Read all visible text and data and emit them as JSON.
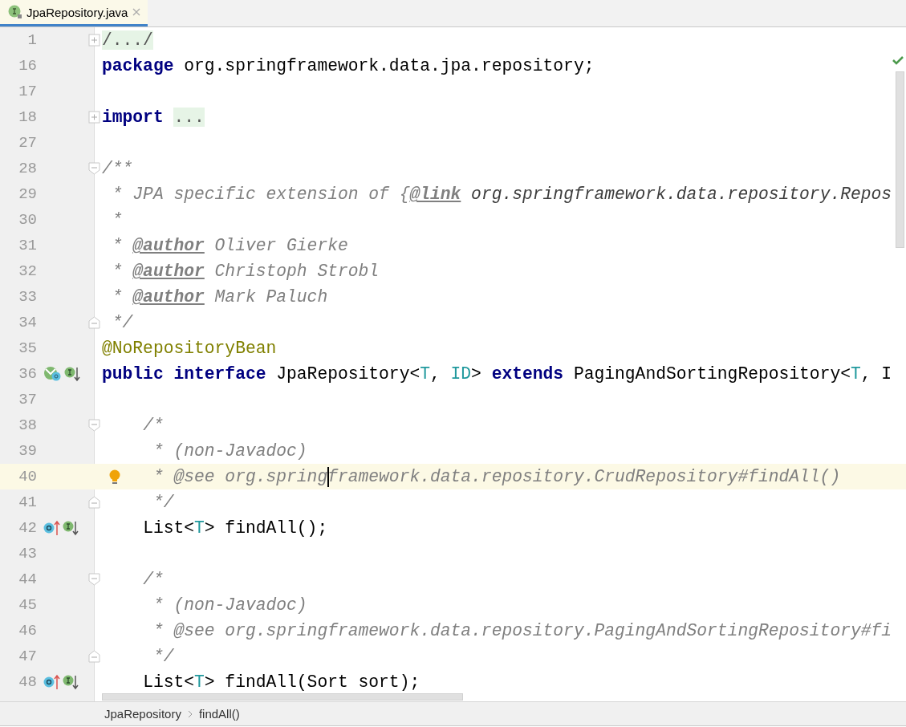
{
  "tabs": [
    {
      "label": "JpaRepository.java",
      "selected": true
    }
  ],
  "lines": [
    {
      "number": "1",
      "fold": {
        "kind": "expand"
      },
      "highlighted": false,
      "tokens": [
        {
          "text": "/.../",
          "kind": "folded"
        }
      ]
    },
    {
      "number": "16",
      "highlighted": false,
      "tokens": [
        {
          "text": "package",
          "kind": "keyword"
        },
        {
          "text": " org.springframework.data.jpa.repository;",
          "kind": "plain"
        }
      ]
    },
    {
      "number": "17",
      "highlighted": false
    },
    {
      "number": "18",
      "fold": {
        "kind": "expand"
      },
      "highlighted": false,
      "tokens": [
        {
          "text": "import ",
          "kind": "keyword"
        },
        {
          "text": "...",
          "kind": "folded"
        }
      ]
    },
    {
      "number": "27",
      "highlighted": false
    },
    {
      "number": "28",
      "fold": {
        "kind": "start"
      },
      "highlighted": false,
      "tokens": [
        {
          "text": "/**",
          "kind": "comment"
        }
      ]
    },
    {
      "number": "29",
      "highlighted": false,
      "tokens": [
        {
          "text": " * JPA specific extension of {",
          "kind": "comment"
        },
        {
          "text": "@link",
          "kind": "doc_tag"
        },
        {
          "text": " org.springframework.data.repository.Repos",
          "kind": "doc_ref"
        }
      ]
    },
    {
      "number": "30",
      "highlighted": false,
      "tokens": [
        {
          "text": " *",
          "kind": "comment"
        }
      ]
    },
    {
      "number": "31",
      "highlighted": false,
      "tokens": [
        {
          "text": " * ",
          "kind": "comment"
        },
        {
          "text": "@author",
          "kind": "doc_tag"
        },
        {
          "text": " Oliver Gierke",
          "kind": "comment"
        }
      ]
    },
    {
      "number": "32",
      "highlighted": false,
      "tokens": [
        {
          "text": " * ",
          "kind": "comment"
        },
        {
          "text": "@author",
          "kind": "doc_tag"
        },
        {
          "text": " Christoph Strobl",
          "kind": "comment"
        }
      ]
    },
    {
      "number": "33",
      "highlighted": false,
      "tokens": [
        {
          "text": " * ",
          "kind": "comment"
        },
        {
          "text": "@author",
          "kind": "doc_tag"
        },
        {
          "text": " Mark Paluch",
          "kind": "comment"
        }
      ]
    },
    {
      "number": "34",
      "fold": {
        "kind": "end"
      },
      "highlighted": false,
      "tokens": [
        {
          "text": " */",
          "kind": "comment"
        }
      ]
    },
    {
      "number": "35",
      "highlighted": false,
      "tokens": [
        {
          "text": "@NoRepositoryBean",
          "kind": "annotation"
        }
      ]
    },
    {
      "number": "36",
      "gutter": [
        {
          "kind": "implemented"
        },
        {
          "kind": "implementing"
        }
      ],
      "highlighted": false,
      "tokens": [
        {
          "text": "public interface",
          "kind": "keyword"
        },
        {
          "text": " JpaRepository<",
          "kind": "plain"
        },
        {
          "text": "T",
          "kind": "type_param"
        },
        {
          "text": ", ",
          "kind": "plain"
        },
        {
          "text": "ID",
          "kind": "type_param"
        },
        {
          "text": "> ",
          "kind": "plain"
        },
        {
          "text": "extends",
          "kind": "keyword"
        },
        {
          "text": " PagingAndSortingRepository<",
          "kind": "plain"
        },
        {
          "text": "T",
          "kind": "type_param"
        },
        {
          "text": ", I",
          "kind": "plain"
        }
      ]
    },
    {
      "number": "37",
      "highlighted": false
    },
    {
      "number": "38",
      "fold": {
        "kind": "start"
      },
      "highlighted": false,
      "tokens": [
        {
          "text": "    /*",
          "kind": "comment"
        }
      ]
    },
    {
      "number": "39",
      "highlighted": false,
      "tokens": [
        {
          "text": "     * (non-Javadoc)",
          "kind": "comment"
        }
      ]
    },
    {
      "number": "40",
      "bulb": true,
      "highlighted": true,
      "tokens": [
        {
          "text": "     * @see org.spring",
          "kind": "comment"
        },
        {
          "text": "framework.data.repository.CrudRepository#findAll()",
          "kind": "comment",
          "caret": true
        }
      ]
    },
    {
      "number": "41",
      "fold": {
        "kind": "end"
      },
      "highlighted": false,
      "tokens": [
        {
          "text": "     */",
          "kind": "comment"
        }
      ]
    },
    {
      "number": "42",
      "gutter": [
        {
          "kind": "overriding"
        },
        {
          "kind": "implementing"
        }
      ],
      "highlighted": false,
      "tokens": [
        {
          "text": "    List<",
          "kind": "plain"
        },
        {
          "text": "T",
          "kind": "type_param"
        },
        {
          "text": "> findAll();",
          "kind": "plain"
        }
      ]
    },
    {
      "number": "43",
      "highlighted": false
    },
    {
      "number": "44",
      "fold": {
        "kind": "start"
      },
      "highlighted": false,
      "tokens": [
        {
          "text": "    /*",
          "kind": "comment"
        }
      ]
    },
    {
      "number": "45",
      "highlighted": false,
      "tokens": [
        {
          "text": "     * (non-Javadoc)",
          "kind": "comment"
        }
      ]
    },
    {
      "number": "46",
      "highlighted": false,
      "tokens": [
        {
          "text": "     * @see org.springframework.data.repository.PagingAndSortingRepository#fi",
          "kind": "comment"
        }
      ]
    },
    {
      "number": "47",
      "fold": {
        "kind": "end"
      },
      "highlighted": false,
      "tokens": [
        {
          "text": "     */",
          "kind": "comment"
        }
      ]
    },
    {
      "number": "48",
      "gutter": [
        {
          "kind": "overriding"
        },
        {
          "kind": "implementing"
        }
      ],
      "highlighted": false,
      "tokens": [
        {
          "text": "    List<",
          "kind": "plain"
        },
        {
          "text": "T",
          "kind": "type_param"
        },
        {
          "text": "> findAll(Sort sort);",
          "kind": "plain"
        }
      ]
    }
  ],
  "breadcrumbs": [
    {
      "label": "JpaRepository"
    },
    {
      "label": "findAll()"
    }
  ]
}
